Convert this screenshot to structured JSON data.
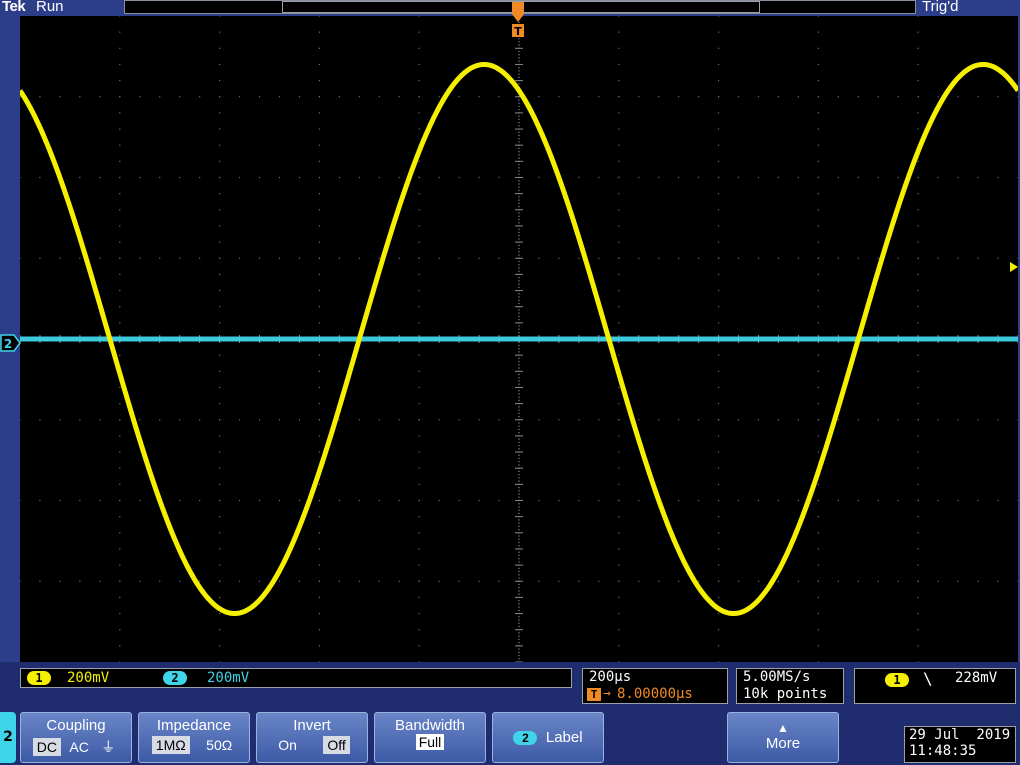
{
  "top": {
    "brand": "Tek",
    "acq_state": "Run",
    "trigger_state": "Trig'd"
  },
  "markers": {
    "trigger_pos": "T",
    "ch2_ground": "2"
  },
  "status": {
    "ch1_num": "1",
    "ch1_scale": "200mV",
    "ch2_num": "2",
    "ch2_scale": "200mV",
    "timebase": "200µs",
    "trig_delay": "8.00000µs",
    "sample_rate": "5.00MS/s",
    "record_length": "10k points",
    "trig_source": "1",
    "trig_slope": "\\",
    "trig_level": "228mV"
  },
  "menu": {
    "channel": "2",
    "coupling": {
      "title": "Coupling",
      "dc": "DC",
      "ac": "AC",
      "gnd": "⏚",
      "selected": "DC"
    },
    "impedance": {
      "title": "Impedance",
      "1m": "1MΩ",
      "50": "50Ω",
      "selected": "1M"
    },
    "invert": {
      "title": "Invert",
      "on": "On",
      "off": "Off",
      "selected": "Off"
    },
    "bandwidth": {
      "title": "Bandwidth",
      "value": "Full"
    },
    "label": {
      "num": "2",
      "text": "Label"
    },
    "more": {
      "text": "More"
    }
  },
  "clock": {
    "date": "29 Jul  2019",
    "time": "11:48:35"
  },
  "colors": {
    "ch1": "#f4f000",
    "ch2": "#3fd4e8",
    "frame": "#2c3e8a",
    "trigger": "#f08a24"
  },
  "chart_data": {
    "type": "line",
    "grid": {
      "divisions_x": 10,
      "divisions_y": 8
    },
    "series": [
      {
        "name": "1",
        "amplitude_div": 3.4,
        "period_div": 5.0,
        "phase_at_left_div": 0.9,
        "offset_div": 0.0
      },
      {
        "name": "2",
        "amplitude_div": 0.0,
        "offset_div": 0.0
      }
    ]
  }
}
